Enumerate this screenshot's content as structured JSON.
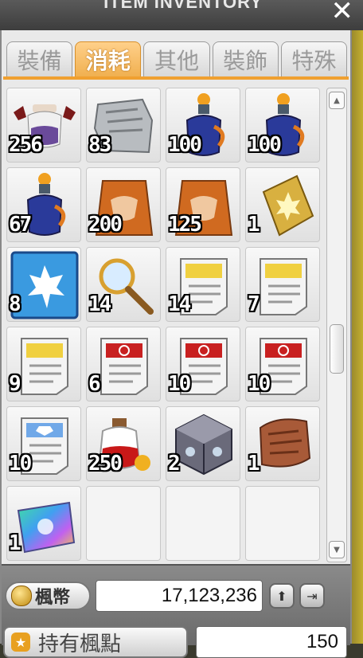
{
  "window": {
    "title": "ITEM INVENTORY",
    "close_label": "✕"
  },
  "tabs": [
    {
      "label": "裝備",
      "active": false
    },
    {
      "label": "消耗",
      "active": true
    },
    {
      "label": "其他",
      "active": false
    },
    {
      "label": "裝飾",
      "active": false
    },
    {
      "label": "特殊",
      "active": false
    }
  ],
  "slots": [
    {
      "icon": "winged-potion-icon",
      "qty": "256"
    },
    {
      "icon": "map-scroll-icon",
      "qty": "83"
    },
    {
      "icon": "blue-elixir-icon",
      "qty": "100"
    },
    {
      "icon": "blue-elixir-icon",
      "qty": "100"
    },
    {
      "icon": "blue-elixir-icon",
      "qty": "67"
    },
    {
      "icon": "fox-bag-icon",
      "qty": "200"
    },
    {
      "icon": "fox-bag-icon",
      "qty": "125"
    },
    {
      "icon": "golden-maple-book-icon",
      "qty": "1"
    },
    {
      "icon": "maple-leaf-card-icon",
      "qty": "8"
    },
    {
      "icon": "magnifying-glass-icon",
      "qty": "14"
    },
    {
      "icon": "yellow-scroll-icon",
      "qty": "14"
    },
    {
      "icon": "yellow-scroll-icon",
      "qty": "7"
    },
    {
      "icon": "yellow-scroll-icon",
      "qty": "9"
    },
    {
      "icon": "red-scroll-icon",
      "qty": "6"
    },
    {
      "icon": "red-scroll-icon",
      "qty": "10"
    },
    {
      "icon": "red-scroll-icon",
      "qty": "10"
    },
    {
      "icon": "blue-gem-scroll-icon",
      "qty": "10"
    },
    {
      "icon": "red-potion-icon",
      "qty": "250"
    },
    {
      "icon": "stone-cube-icon",
      "qty": "2"
    },
    {
      "icon": "old-parchment-icon",
      "qty": "1"
    },
    {
      "icon": "rainbow-scroll-icon",
      "qty": "1"
    },
    {
      "icon": "",
      "qty": ""
    },
    {
      "icon": "",
      "qty": ""
    },
    {
      "icon": "",
      "qty": ""
    }
  ],
  "footer": {
    "meso_label": "楓幣",
    "meso_amount": "17,123,236",
    "maple_points_label": "持有楓點",
    "maple_points_amount": "150"
  },
  "colors": {
    "active_tab": "#f0b050",
    "panel": "#e9e9e9",
    "accent": "#f0a030"
  }
}
